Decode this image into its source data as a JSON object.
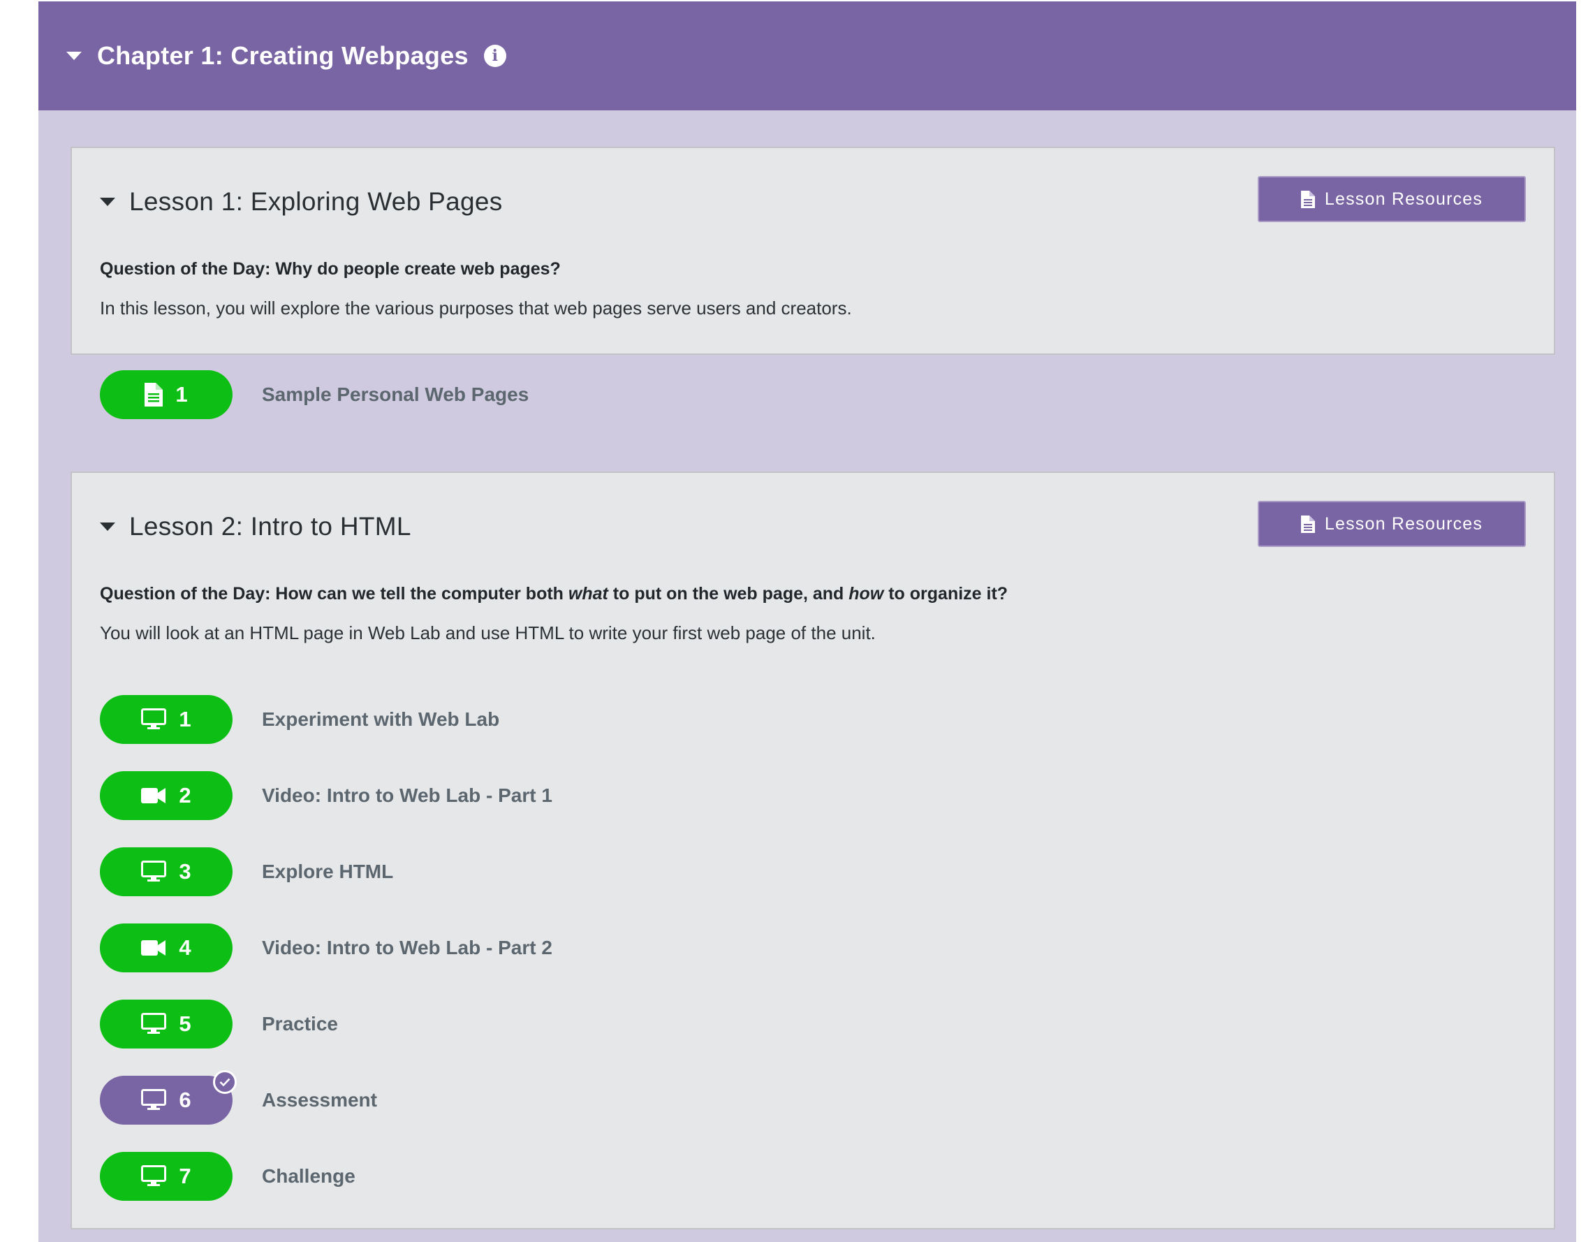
{
  "chapter": {
    "title": "Chapter 1: Creating Webpages"
  },
  "lessons": [
    {
      "title": "Lesson 1: Exploring Web Pages",
      "resources_label": "Lesson Resources",
      "question": "Question of the Day: Why do people create web pages?",
      "description": "In this lesson, you will explore the various purposes that web pages serve users and creators.",
      "activities": [
        {
          "number": "1",
          "icon": "document-icon",
          "label": "Sample Personal Web Pages",
          "status": "in-progress"
        }
      ]
    },
    {
      "title": "Lesson 2: Intro to HTML",
      "resources_label": "Lesson Resources",
      "question_parts": [
        "Question of the Day: How can we tell the computer both ",
        "what",
        " to put on the web page, and ",
        "how",
        " to organize it?"
      ],
      "description": "You will look at an HTML page in Web Lab and use HTML to write your first web page of the unit.",
      "activities": [
        {
          "number": "1",
          "icon": "desktop-icon",
          "label": "Experiment with Web Lab",
          "status": "in-progress"
        },
        {
          "number": "2",
          "icon": "video-icon",
          "label": "Video: Intro to Web Lab - Part 1",
          "status": "in-progress"
        },
        {
          "number": "3",
          "icon": "desktop-icon",
          "label": "Explore HTML",
          "status": "in-progress"
        },
        {
          "number": "4",
          "icon": "video-icon",
          "label": "Video: Intro to Web Lab - Part 2",
          "status": "in-progress"
        },
        {
          "number": "5",
          "icon": "desktop-icon",
          "label": "Practice",
          "status": "in-progress"
        },
        {
          "number": "6",
          "icon": "desktop-icon",
          "label": "Assessment",
          "status": "submitted"
        },
        {
          "number": "7",
          "icon": "desktop-icon",
          "label": "Challenge",
          "status": "in-progress"
        }
      ]
    }
  ],
  "colors": {
    "chapter_header": "#7a65a4",
    "chapter_bg": "#cfcadf",
    "lesson_bg": "#e6e7e9",
    "progress_green": "#0dbf14",
    "submitted_purple": "#7a65a4"
  }
}
